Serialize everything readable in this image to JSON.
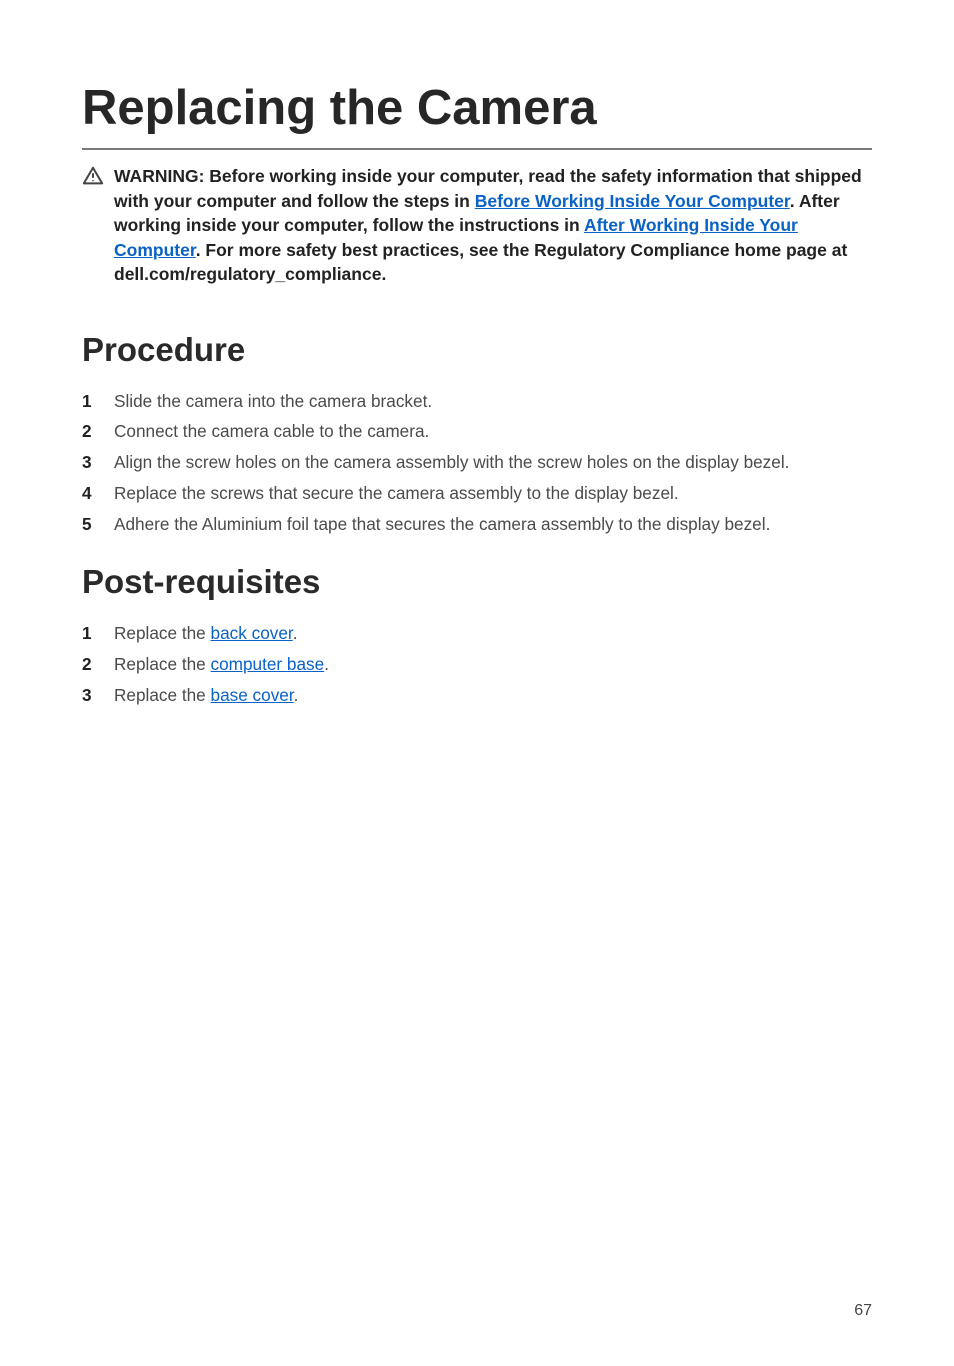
{
  "title": "Replacing the Camera",
  "warning": {
    "prefix": "WARNING: Before working inside your computer, read the safety information that shipped with your computer and follow the steps in ",
    "link1": "Before Working Inside Your Computer",
    "mid1": ". After working inside your computer, follow the instructions in ",
    "link2": "After Working Inside Your Computer",
    "suffix": ". For more safety best practices, see the Regulatory Compliance home page at dell.com/regulatory_compliance."
  },
  "sections": {
    "procedure": {
      "heading": "Procedure",
      "steps": [
        "Slide the camera into the camera bracket.",
        "Connect the camera cable to the camera.",
        "Align the screw holes on the camera assembly with the screw holes on the display bezel.",
        "Replace the screws that secure the camera assembly to the display bezel.",
        "Adhere the Aluminium foil tape that secures the camera assembly to the display bezel."
      ]
    },
    "post": {
      "heading": "Post-requisites",
      "steps": [
        {
          "pre": "Replace the ",
          "link": "back cover",
          "post": "."
        },
        {
          "pre": "Replace the ",
          "link": "computer base",
          "post": "."
        },
        {
          "pre": "Replace the ",
          "link": "base cover",
          "post": "."
        }
      ]
    }
  },
  "page_number": "67"
}
